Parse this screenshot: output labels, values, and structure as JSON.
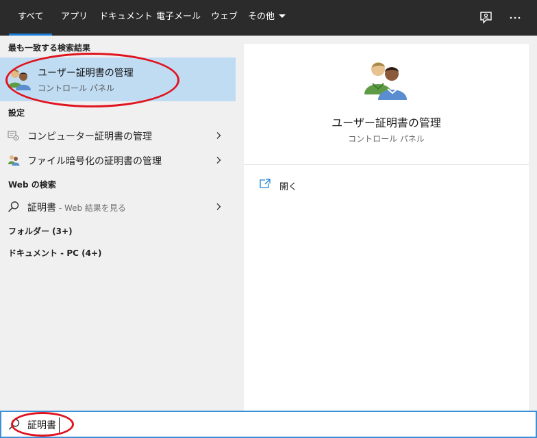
{
  "tabs": [
    {
      "label": "すべて",
      "active": true
    },
    {
      "label": "アプリ"
    },
    {
      "label": "ドキュメント"
    },
    {
      "label": "電子メール"
    },
    {
      "label": "ウェブ"
    },
    {
      "label": "その他",
      "dropdown": true
    }
  ],
  "top_icons": [
    "feedback-icon",
    "more-options-icon"
  ],
  "sections": {
    "best_match": "最も一致する検索結果",
    "settings": "設定",
    "web_search": "Web の検索",
    "folders": "フォルダー (3+)",
    "documents": "ドキュメント - PC (4+)"
  },
  "best_match": {
    "title": "ユーザー証明書の管理",
    "subtitle": "コントロール パネル"
  },
  "settings_items": [
    {
      "label": "コンピューター証明書の管理",
      "icon": "certificate-gear-icon"
    },
    {
      "label": "ファイル暗号化の証明書の管理",
      "icon": "users-icon"
    }
  ],
  "web_item": {
    "label": "証明書",
    "hint": " - Web 結果を見る"
  },
  "preview": {
    "title": "ユーザー証明書の管理",
    "subtitle": "コントロール パネル",
    "open_label": "開く"
  },
  "search": {
    "value": "証明書"
  },
  "colors": {
    "topbar": "#2b2b2b",
    "accent": "#1a80d6",
    "selection": "#c0dcf3",
    "annotation": "#e0141e"
  }
}
